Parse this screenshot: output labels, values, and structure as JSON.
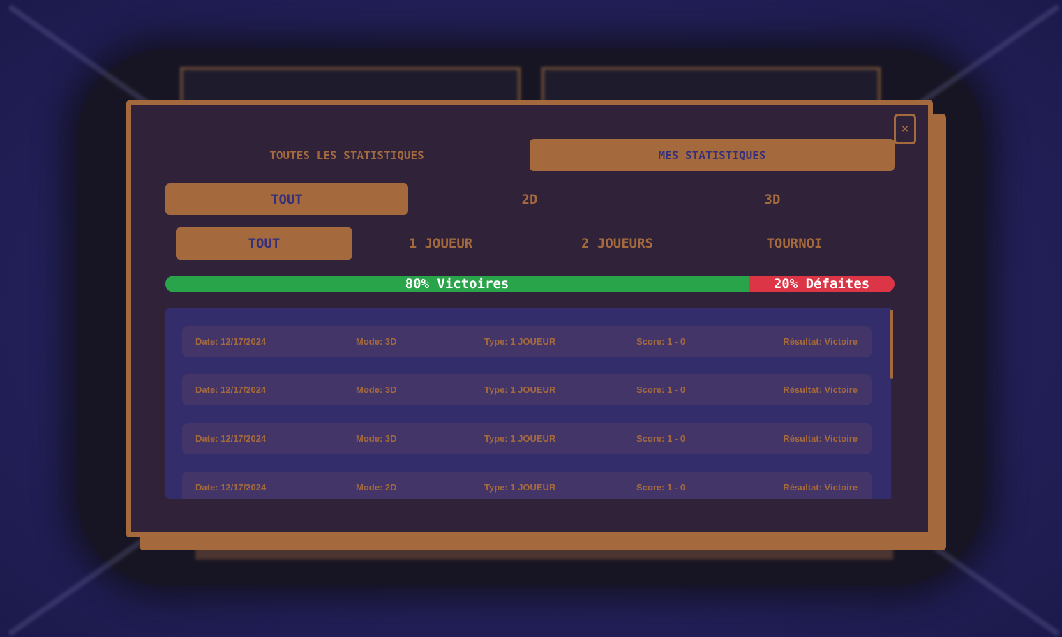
{
  "modal": {
    "close_label": "×",
    "main_tabs": [
      {
        "label": "TOUTES LES STATISTIQUES",
        "active": false
      },
      {
        "label": "MES STATISTIQUES",
        "active": true
      }
    ],
    "dimension_tabs": [
      {
        "label": "TOUT",
        "active": true
      },
      {
        "label": "2D",
        "active": false
      },
      {
        "label": "3D",
        "active": false
      }
    ],
    "type_tabs": [
      {
        "label": "TOUT",
        "active": true
      },
      {
        "label": "1 JOUEUR",
        "active": false
      },
      {
        "label": "2 JOUEURS",
        "active": false
      },
      {
        "label": "TOURNOI",
        "active": false
      }
    ],
    "ratio": {
      "win_fraction": 0.8,
      "win_label": "80% Victoires",
      "loss_label": "20% Défaites"
    },
    "matches": [
      {
        "date": "Date: 12/17/2024",
        "mode": "Mode: 3D",
        "type": "Type: 1 JOUEUR",
        "score": "Score: 1 - 0",
        "result": "Résultat: Victoire"
      },
      {
        "date": "Date: 12/17/2024",
        "mode": "Mode: 3D",
        "type": "Type: 1 JOUEUR",
        "score": "Score: 1 - 0",
        "result": "Résultat: Victoire"
      },
      {
        "date": "Date: 12/17/2024",
        "mode": "Mode: 3D",
        "type": "Type: 1 JOUEUR",
        "score": "Score: 1 - 0",
        "result": "Résultat: Victoire"
      },
      {
        "date": "Date: 12/17/2024",
        "mode": "Mode: 2D",
        "type": "Type: 1 JOUEUR",
        "score": "Score: 1 - 0",
        "result": "Résultat: Victoire"
      }
    ]
  },
  "colors": {
    "accent": "#a46a3e",
    "modal_bg": "#2f2239",
    "list_bg": "#332d6b",
    "row_bg": "#433567",
    "win": "#2aa44a",
    "loss": "#dc3545"
  }
}
